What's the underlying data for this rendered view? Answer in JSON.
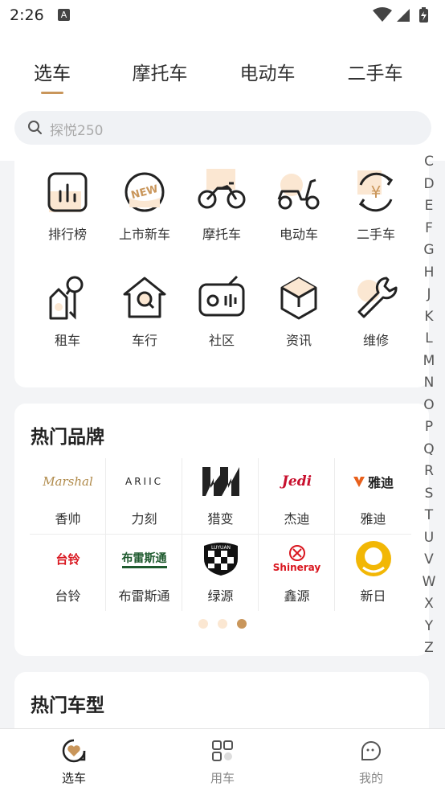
{
  "status": {
    "time": "2:26",
    "notif_letter": "A"
  },
  "tabs": [
    {
      "label": "选车",
      "active": true
    },
    {
      "label": "摩托车",
      "active": false
    },
    {
      "label": "电动车",
      "active": false
    },
    {
      "label": "二手车",
      "active": false
    }
  ],
  "search": {
    "placeholder": "探悦250"
  },
  "functions": [
    {
      "label": "排行榜",
      "icon": "ranking-icon"
    },
    {
      "label": "上市新车",
      "icon": "new-car-icon"
    },
    {
      "label": "摩托车",
      "icon": "motorcycle-icon"
    },
    {
      "label": "电动车",
      "icon": "scooter-icon"
    },
    {
      "label": "二手车",
      "icon": "used-car-icon"
    },
    {
      "label": "租车",
      "icon": "rent-key-icon"
    },
    {
      "label": "车行",
      "icon": "dealer-house-icon"
    },
    {
      "label": "社区",
      "icon": "radio-icon"
    },
    {
      "label": "资讯",
      "icon": "cube-icon"
    },
    {
      "label": "维修",
      "icon": "wrench-icon"
    }
  ],
  "brands_section": {
    "title": "热门品牌",
    "brands": [
      {
        "name": "香帅",
        "logo_text": "Marshal",
        "color": "#b08a4a"
      },
      {
        "name": "力刻",
        "logo_text": "ARIIC",
        "color": "#222222"
      },
      {
        "name": "猎变",
        "logo_text": "LB",
        "color": "#222222"
      },
      {
        "name": "杰迪",
        "logo_text": "Jedi",
        "color": "#c8102e"
      },
      {
        "name": "雅迪",
        "logo_text": "雅迪",
        "color": "#e8601c"
      },
      {
        "name": "台铃",
        "logo_text": "台铃",
        "color": "#d9161f"
      },
      {
        "name": "布雷斯通",
        "logo_text": "布雷斯通",
        "color": "#1e5a2e"
      },
      {
        "name": "绿源",
        "logo_text": "LUYUAN",
        "color": "#111111"
      },
      {
        "name": "鑫源",
        "logo_text": "Shineray",
        "color": "#d9161f"
      },
      {
        "name": "新日",
        "logo_text": "",
        "color": "#f2b705"
      }
    ],
    "pages": 3,
    "current_page": 3
  },
  "models_section": {
    "title": "热门车型"
  },
  "alphabet": [
    "C",
    "D",
    "E",
    "F",
    "G",
    "H",
    "J",
    "K",
    "L",
    "M",
    "N",
    "O",
    "P",
    "Q",
    "R",
    "S",
    "T",
    "U",
    "V",
    "W",
    "X",
    "Y",
    "Z"
  ],
  "bottom_nav": [
    {
      "label": "选车",
      "icon": "select-car-icon",
      "active": true
    },
    {
      "label": "用车",
      "icon": "use-car-grid-icon",
      "active": false
    },
    {
      "label": "我的",
      "icon": "profile-icon",
      "active": false
    }
  ],
  "colors": {
    "accent": "#c9965b",
    "accent_light": "#fbe7d2",
    "background": "#f3f4f6"
  }
}
